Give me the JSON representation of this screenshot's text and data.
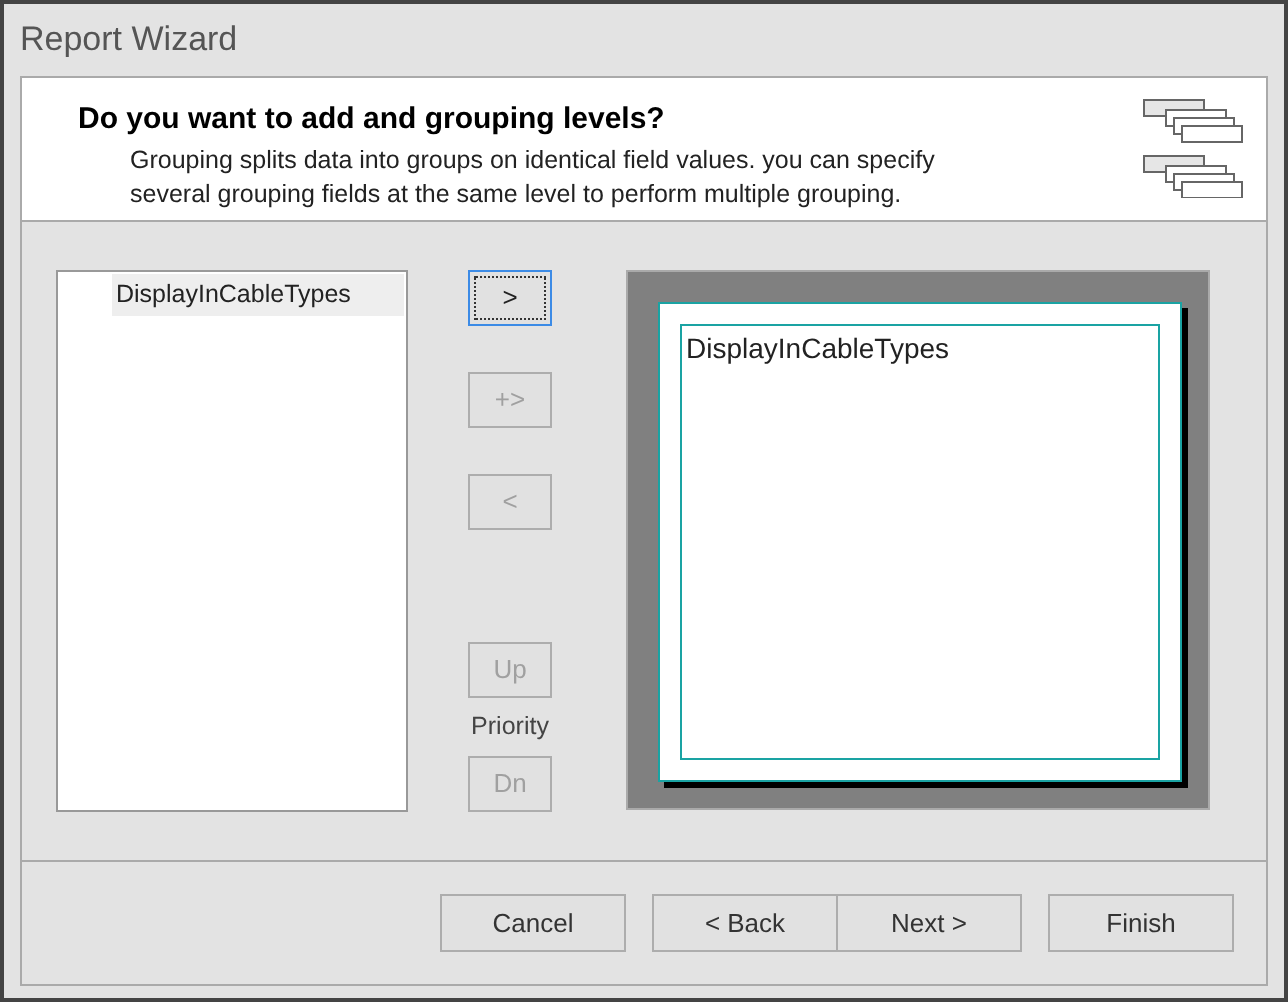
{
  "window": {
    "title": "Report Wizard"
  },
  "header": {
    "title": "Do you want to add and grouping levels?",
    "description": "Grouping splits data into groups on identical field values. you can specify several grouping fields at the same level to perform multiple grouping."
  },
  "available_fields": [
    {
      "label": "DisplayInCableTypes",
      "selected": true
    }
  ],
  "move_buttons": [
    {
      "label": ">",
      "disabled": false,
      "focused": true
    },
    {
      "label": "+>",
      "disabled": true,
      "focused": false
    },
    {
      "label": "<",
      "disabled": true,
      "focused": false
    }
  ],
  "priority": {
    "up": {
      "label": "Up",
      "disabled": true
    },
    "label": "Priority",
    "down": {
      "label": "Dn",
      "disabled": true
    }
  },
  "preview": {
    "groups": [
      "DisplayInCableTypes"
    ]
  },
  "footer_buttons": [
    {
      "label": "Cancel",
      "disabled": false
    },
    {
      "label": "< Back",
      "disabled": false
    },
    {
      "label": "Next >",
      "disabled": false
    },
    {
      "label": "Finish",
      "disabled": false
    }
  ]
}
